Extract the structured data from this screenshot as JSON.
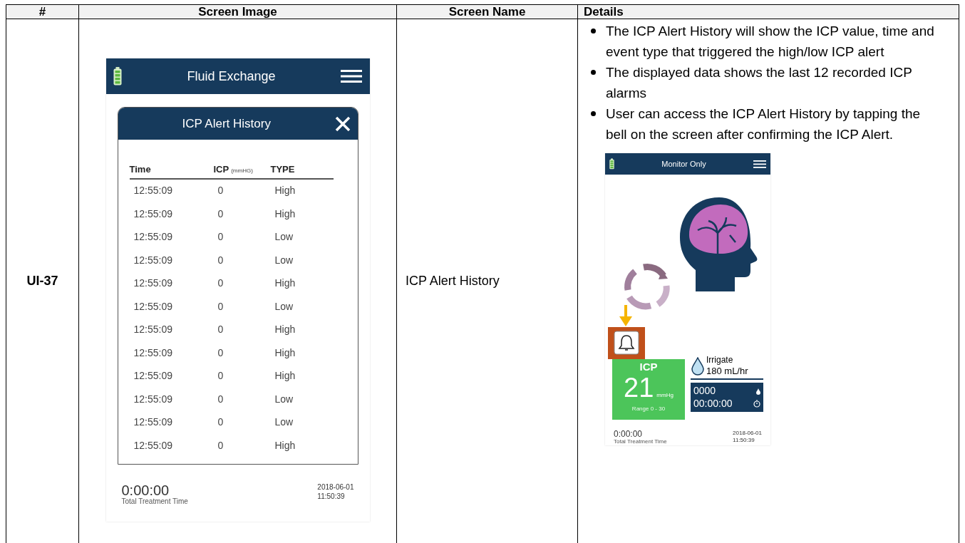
{
  "table": {
    "columns": [
      "#",
      "Screen Image",
      "Screen Name",
      "Details"
    ],
    "rows": [
      {
        "id": "UI-37",
        "screen_name": "ICP Alert History",
        "screen_image": {
          "header_title": "Fluid Exchange",
          "dialog": {
            "title": "ICP Alert History",
            "columns": [
              {
                "label": "Time"
              },
              {
                "label": "ICP",
                "unit": "(mmHG)"
              },
              {
                "label": "TYPE"
              }
            ],
            "rows": [
              {
                "time": "12:55:09",
                "icp": "0",
                "type": "High"
              },
              {
                "time": "12:55:09",
                "icp": "0",
                "type": "High"
              },
              {
                "time": "12:55:09",
                "icp": "0",
                "type": "Low"
              },
              {
                "time": "12:55:09",
                "icp": "0",
                "type": "Low"
              },
              {
                "time": "12:55:09",
                "icp": "0",
                "type": "High"
              },
              {
                "time": "12:55:09",
                "icp": "0",
                "type": "Low"
              },
              {
                "time": "12:55:09",
                "icp": "0",
                "type": "High"
              },
              {
                "time": "12:55:09",
                "icp": "0",
                "type": "High"
              },
              {
                "time": "12:55:09",
                "icp": "0",
                "type": "High"
              },
              {
                "time": "12:55:09",
                "icp": "0",
                "type": "Low"
              },
              {
                "time": "12:55:09",
                "icp": "0",
                "type": "Low"
              },
              {
                "time": "12:55:09",
                "icp": "0",
                "type": "High"
              }
            ]
          },
          "footer": {
            "elapsed": "0:00:00",
            "elapsed_label": "Total Treatment Time",
            "date": "2018-06-01",
            "time": "11:50:39"
          }
        },
        "details": {
          "bullets": [
            "The ICP Alert History will show the ICP value, time and event type that triggered the high/low ICP alert",
            "The displayed data shows the last 12 recorded ICP alarms",
            "User can access the ICP Alert History by tapping the bell on the screen after confirming the ICP Alert."
          ],
          "screenshot": {
            "header_title": "Monitor Only",
            "icp": {
              "label": "ICP",
              "value": "21",
              "unit": "mmHg",
              "range": "Range 0 - 30"
            },
            "irrigate": {
              "label": "Irrigate",
              "rate": "180 mL/hr"
            },
            "volume": "0000",
            "timer": "00:00:00",
            "footer": {
              "elapsed": "0:00:00",
              "elapsed_label": "Total Treatment Time",
              "date": "2018-06-01",
              "time": "11:50:39"
            }
          }
        }
      }
    ]
  }
}
